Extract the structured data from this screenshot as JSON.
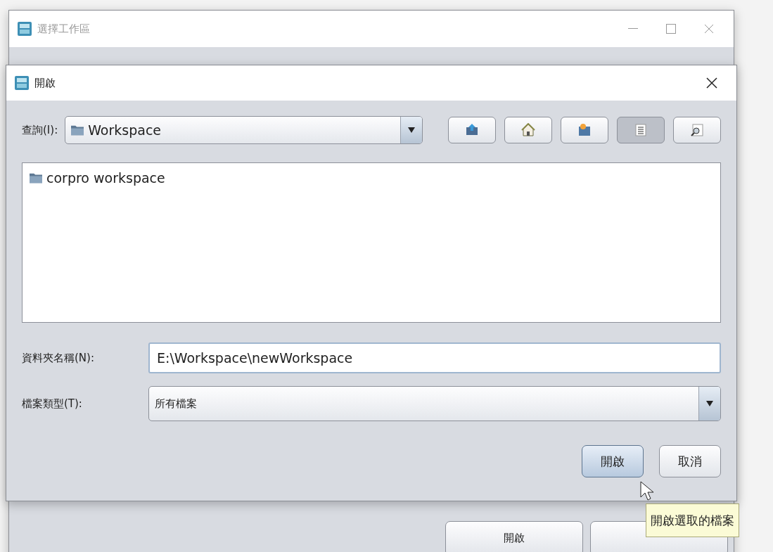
{
  "background_window": {
    "title": "選擇工作區",
    "buttons": [
      {
        "label": "開啟"
      }
    ]
  },
  "dialog": {
    "title": "開啟",
    "look_in": {
      "label": "查詢(I):",
      "value": "Workspace"
    },
    "toolbar": [
      {
        "kind": "up",
        "selected": false
      },
      {
        "kind": "home",
        "selected": false
      },
      {
        "kind": "new-folder",
        "selected": false
      },
      {
        "kind": "list",
        "selected": true
      },
      {
        "kind": "details",
        "selected": false
      }
    ],
    "files": [
      {
        "name": "corpro workspace",
        "selected": false
      }
    ],
    "folder_name": {
      "label": "資料夾名稱(N):",
      "value": "E:\\Workspace\\newWorkspace"
    },
    "file_type": {
      "label": "檔案類型(T):",
      "value": "所有檔案"
    },
    "buttons": [
      {
        "label": "開啟",
        "focused": true
      },
      {
        "label": "取消",
        "focused": false
      }
    ]
  },
  "tooltip": "開啟選取的檔案"
}
